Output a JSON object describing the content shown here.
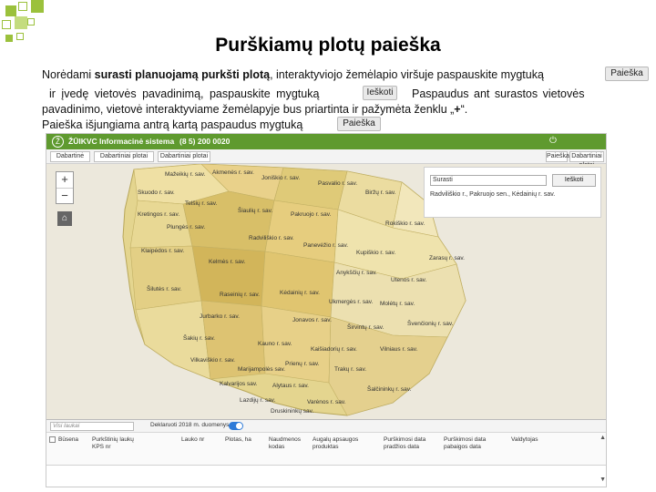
{
  "page": {
    "title": "Purškiamų plotų paieška"
  },
  "instructions": {
    "line1_start": "Norėdami ",
    "line1_bold": "surasti planuojamą purkšti plotą",
    "line1_end": ", interaktyviojo žemėlapio viršuje paspauskite mygtuką",
    "line2_a": "ir įvedę vietovės pavadinimą, paspauskite mygtuką",
    "line2_b": "Paspaudus ant surastos vietovės",
    "line3": "pavadinimo, vietovė interaktyviame žemėlapyje bus priartinta ir pažymėta ženklu „",
    "line3_bold": "+",
    "line3_end": "“.",
    "line4": "Paieška išjungiama antrą kartą paspaudus mygtuką",
    "btn_paieska": "Paieška",
    "btn_ieskoti": "Ieškoti"
  },
  "app": {
    "header": {
      "logo": "Ž",
      "system_name": "ŽŪIKVC Informacinė sistema",
      "phone": "(8 5) 200 0020",
      "power_icon": "power-icon"
    },
    "tabs_left": [
      "Dabartinė",
      "Dabartiniai plotai",
      "Dabartiniai plotai"
    ],
    "tabs_right": [
      "Paieška",
      "Dabartiniai plotai"
    ],
    "map": {
      "zoom_in": "+",
      "zoom_out": "−",
      "home": "⌂",
      "search": {
        "input_value": "Surasti",
        "button_label": "Ieškoti",
        "result": "Radviliškio r., Pakruojo sen., Kėdainių r. sav."
      },
      "region_labels": [
        "Mažeikių r. sav.",
        "Akmenės r. sav.",
        "Joniškio r. sav.",
        "Pasvalio r. sav.",
        "Biržų r. sav.",
        "Skuodo r. sav.",
        "Telšių r. sav.",
        "Šiaulių r. sav.",
        "Pakruojo r. sav.",
        "Rokiškio r. sav.",
        "Kretingos r. sav.",
        "Plungės r. sav.",
        "Radviliškio r. sav.",
        "Panevėžio r. sav.",
        "Kupiškio r. sav.",
        "Klaipėdos r. sav.",
        "Kelmės r. sav.",
        "Anykščių r. sav.",
        "Utenos r. sav.",
        "Zarasų r. sav.",
        "Šilutės r. sav.",
        "Raseinių r. sav.",
        "Kėdainių r. sav.",
        "Ukmergės r. sav.",
        "Molėtų r. sav.",
        "Jurbarko r. sav.",
        "Jonavos r. sav.",
        "Širvintų r. sav.",
        "Švenčionių r. sav.",
        "Šakių r. sav.",
        "Kauno r. sav.",
        "Kaišiadorių r. sav.",
        "Vilniaus r. sav.",
        "Vilkaviškio r. sav.",
        "Marijampolės sav.",
        "Prienų r. sav.",
        "Trakų r. sav.",
        "Kalvarijos sav.",
        "Alytaus r. sav.",
        "Šalčininkų r. sav.",
        "Lazdijų r. sav.",
        "Varėnos r. sav.",
        "Druskininkų sav."
      ]
    },
    "grid": {
      "search_placeholder": "Visi laukai",
      "filter_label": "Deklaruoti 2018 m. duomenys",
      "columns": [
        "Būsena",
        "Purkštinių laukų KPS nr",
        "Lauko nr",
        "Plotas, ha",
        "Naudmenos kodas",
        "Augalų apsaugos produktas",
        "Purškimosi data pradžios data",
        "Purškimosi data pabaigos data",
        "Valdytojas"
      ]
    }
  }
}
